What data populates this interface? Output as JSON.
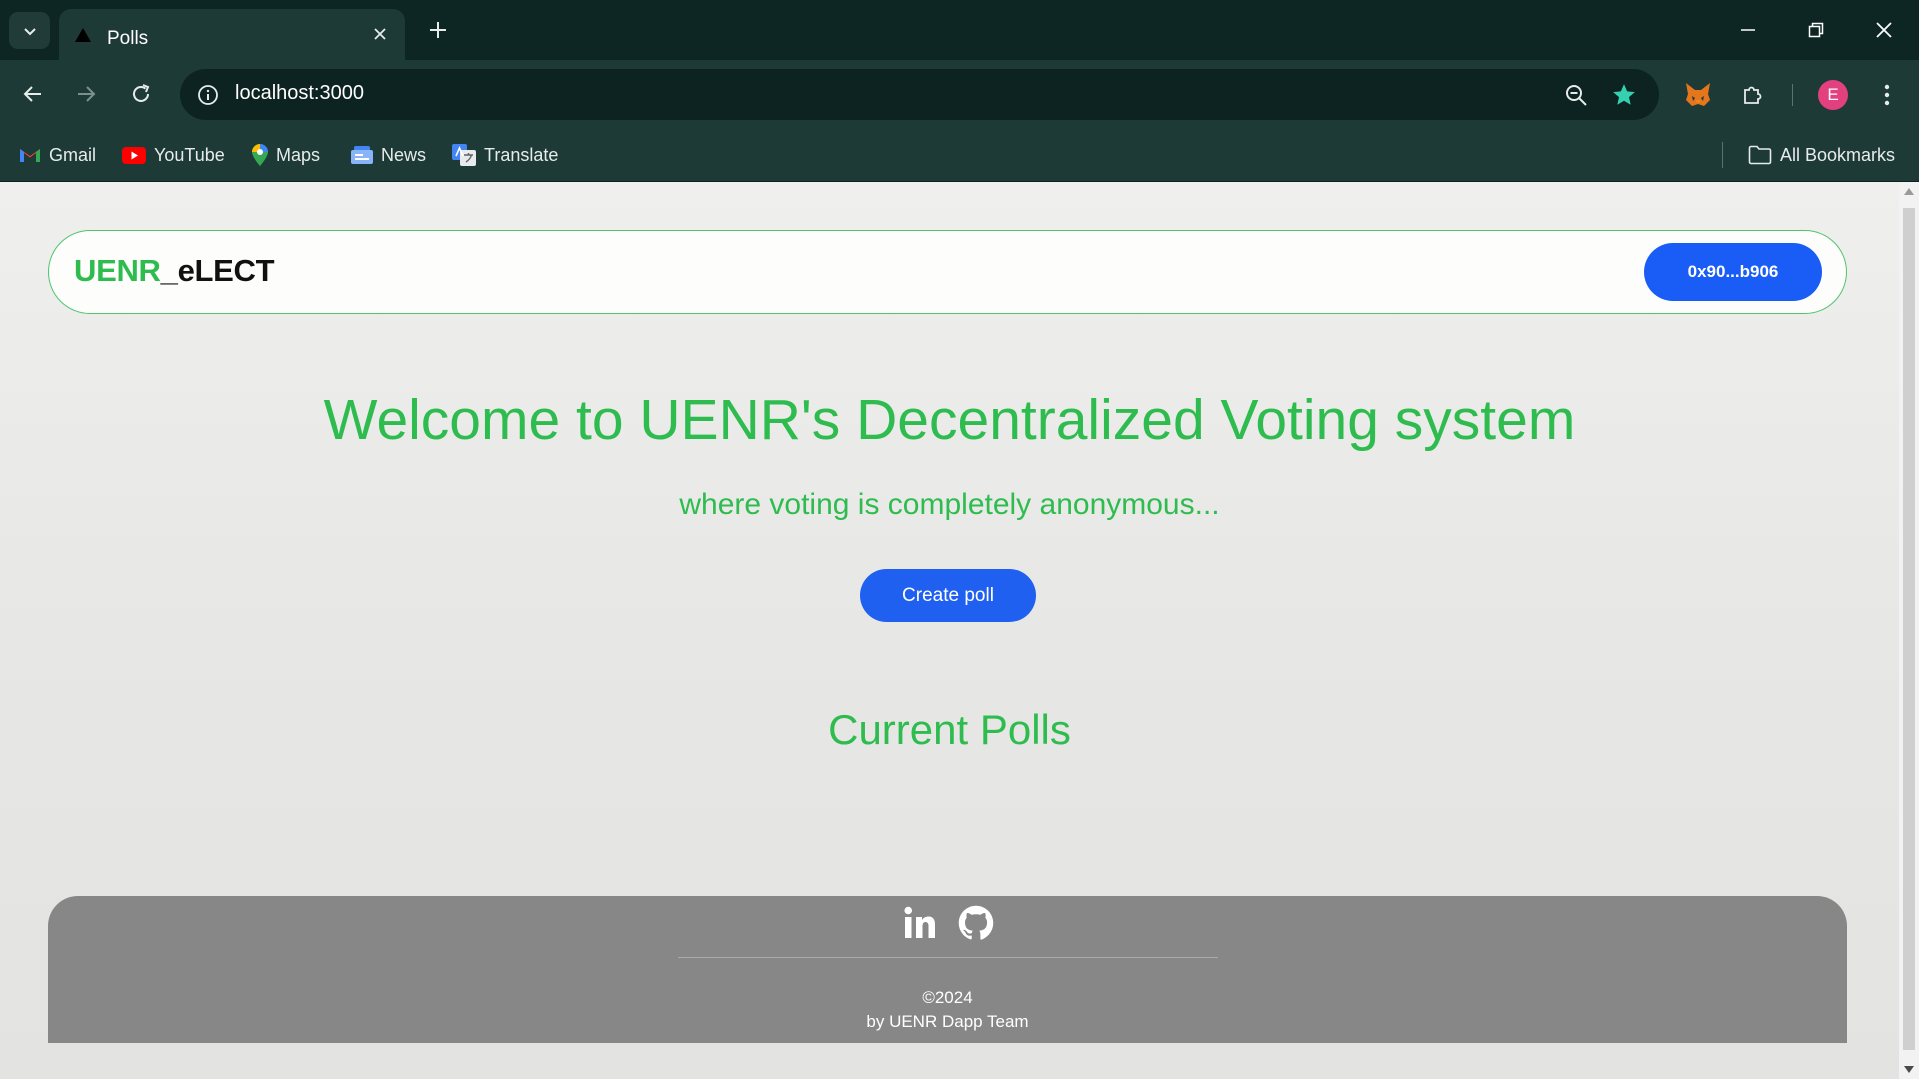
{
  "browser": {
    "tab": {
      "title": "Polls",
      "icon": "triangle-favicon-icon"
    },
    "address": {
      "url": "localhost:3000"
    },
    "bookmarks": [
      {
        "label": "Gmail",
        "icon": "gmail-icon"
      },
      {
        "label": "YouTube",
        "icon": "youtube-icon"
      },
      {
        "label": "Maps",
        "icon": "maps-icon"
      },
      {
        "label": "News",
        "icon": "news-icon"
      },
      {
        "label": "Translate",
        "icon": "translate-icon"
      }
    ],
    "all_bookmarks_label": "All Bookmarks",
    "profile_initial": "E",
    "colors": {
      "chrome_dark": "#0d2523",
      "chrome_toolbar": "#1e3a37",
      "star": "#35d0b0",
      "avatar": "#e34080"
    }
  },
  "page": {
    "logo": {
      "part1": "UENR",
      "part2": "_eLECT"
    },
    "wallet_label": "0x90...b906",
    "hero_title": "Welcome to UENR's Decentralized Voting system",
    "hero_subtitle": "where voting is completely anonymous...",
    "create_poll_label": "Create poll",
    "section_title": "Current Polls",
    "footer": {
      "social_icons": [
        "linkedin-icon",
        "github-icon"
      ],
      "copyright": "©2024",
      "team": "by UENR Dapp Team"
    },
    "colors": {
      "accent_green": "#2ebc4f",
      "primary_blue": "#1a5cf6",
      "footer_bg": "#878787"
    }
  }
}
